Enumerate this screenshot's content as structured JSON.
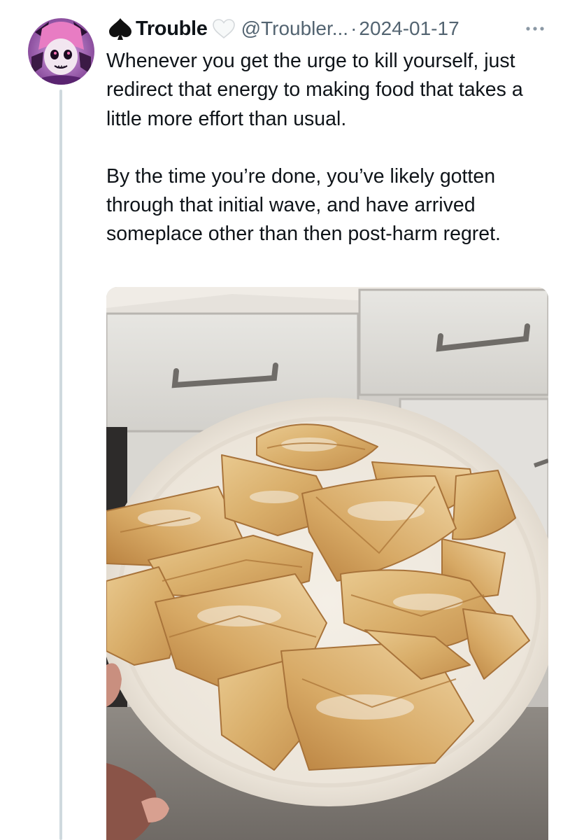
{
  "tweet": {
    "display_name": "Trouble",
    "handle": "@Troubler...",
    "separator": "·",
    "date": "2024-01-17",
    "name_emoji_left": "spade-icon",
    "name_emoji_right": "white-heart-icon",
    "paragraphs": [
      "Whenever you get the urge to kill yourself, just redirect that energy to making food that takes a little more effort than usual.",
      "By the time you’re done, you’ve likely gotten through that initial wave, and have arrived someplace other than then post-harm regret."
    ]
  },
  "media": {
    "kind": "photo",
    "subject": "plate of baked folded pastries held over kitchen counter"
  },
  "colors": {
    "text": "#0f1419",
    "secondary": "#536471",
    "thread_line": "#cfd9de"
  }
}
